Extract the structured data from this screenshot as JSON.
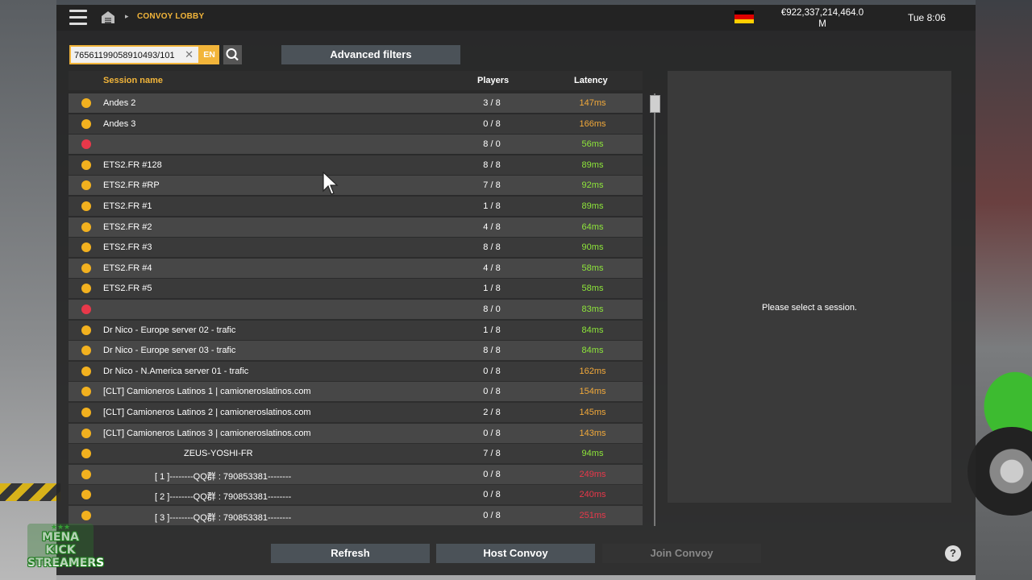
{
  "header": {
    "breadcrumb": "CONVOY LOBBY",
    "money": "€922,337,214,464.0",
    "money_unit": "M",
    "clock": "Tue 8:06",
    "flag_colors": [
      "#000000",
      "#dd0000",
      "#ffce00"
    ]
  },
  "search": {
    "value": "76561199058910493/101",
    "lang": "EN",
    "advanced_label": "Advanced filters"
  },
  "table": {
    "columns": [
      "Session name",
      "Players",
      "Latency"
    ],
    "rows": [
      {
        "status": "ok",
        "name": "Andes 2",
        "players": "3 / 8",
        "latency": "147ms",
        "lat_color": "#f2a93a",
        "indent": 0
      },
      {
        "status": "ok",
        "name": "Andes 3",
        "players": "0 / 8",
        "latency": "166ms",
        "lat_color": "#f2a93a",
        "indent": 0
      },
      {
        "status": "bad",
        "name": "",
        "players": "8 / 0",
        "latency": "56ms",
        "lat_color": "#8ee63a",
        "indent": 0
      },
      {
        "status": "ok",
        "name": "ETS2.FR #128",
        "players": "8 / 8",
        "latency": "89ms",
        "lat_color": "#8ee63a",
        "indent": 0
      },
      {
        "status": "ok",
        "name": "ETS2.FR #RP",
        "players": "7 / 8",
        "latency": "92ms",
        "lat_color": "#8ee63a",
        "indent": 0
      },
      {
        "status": "ok",
        "name": "ETS2.FR #1",
        "players": "1 / 8",
        "latency": "89ms",
        "lat_color": "#8ee63a",
        "indent": 0
      },
      {
        "status": "ok",
        "name": "ETS2.FR #2",
        "players": "4 / 8",
        "latency": "64ms",
        "lat_color": "#8ee63a",
        "indent": 0
      },
      {
        "status": "ok",
        "name": "ETS2.FR #3",
        "players": "8 / 8",
        "latency": "90ms",
        "lat_color": "#8ee63a",
        "indent": 0
      },
      {
        "status": "ok",
        "name": "ETS2.FR #4",
        "players": "4 / 8",
        "latency": "58ms",
        "lat_color": "#8ee63a",
        "indent": 0
      },
      {
        "status": "ok",
        "name": "ETS2.FR #5",
        "players": "1 / 8",
        "latency": "58ms",
        "lat_color": "#8ee63a",
        "indent": 0
      },
      {
        "status": "bad",
        "name": "",
        "players": "8 / 0",
        "latency": "83ms",
        "lat_color": "#8ee63a",
        "indent": 0
      },
      {
        "status": "ok",
        "name": "Dr Nico - Europe server 02 - trafic",
        "players": "1 / 8",
        "latency": "84ms",
        "lat_color": "#8ee63a",
        "indent": 0
      },
      {
        "status": "ok",
        "name": "Dr Nico - Europe server 03 - trafic",
        "players": "8 / 8",
        "latency": "84ms",
        "lat_color": "#8ee63a",
        "indent": 0
      },
      {
        "status": "ok",
        "name": "Dr Nico - N.America server 01 - trafic",
        "players": "0 / 8",
        "latency": "162ms",
        "lat_color": "#f2a93a",
        "indent": 0
      },
      {
        "status": "ok",
        "name": "[CLT] Camioneros Latinos 1 | camioneroslatinos.com",
        "players": "0 / 8",
        "latency": "154ms",
        "lat_color": "#f2a93a",
        "indent": 0
      },
      {
        "status": "ok",
        "name": "[CLT] Camioneros Latinos 2 | camioneroslatinos.com",
        "players": "2 / 8",
        "latency": "145ms",
        "lat_color": "#f2a93a",
        "indent": 0
      },
      {
        "status": "ok",
        "name": "[CLT] Camioneros Latinos 3 | camioneroslatinos.com",
        "players": "0 / 8",
        "latency": "143ms",
        "lat_color": "#f2a93a",
        "indent": 0
      },
      {
        "status": "ok",
        "name": "ZEUS-YOSHI-FR",
        "players": "7 / 8",
        "latency": "94ms",
        "lat_color": "#8ee63a",
        "indent": 2
      },
      {
        "status": "ok",
        "name": "[ 1 ]--------QQ群 : 790853381--------",
        "players": "0 / 8",
        "latency": "249ms",
        "lat_color": "#e8384a",
        "indent": 1
      },
      {
        "status": "ok",
        "name": "[ 2 ]--------QQ群 : 790853381--------",
        "players": "0 / 8",
        "latency": "240ms",
        "lat_color": "#e8384a",
        "indent": 1
      },
      {
        "status": "ok",
        "name": "[ 3 ]--------QQ群 : 790853381--------",
        "players": "0 / 8",
        "latency": "251ms",
        "lat_color": "#e8384a",
        "indent": 1
      }
    ]
  },
  "detail": {
    "placeholder": "Please select a session."
  },
  "footer": {
    "refresh": "Refresh",
    "host": "Host Convoy",
    "join": "Join Convoy",
    "help": "?"
  },
  "logo": {
    "line1": "MENA KICK",
    "line2": "STREAMERS",
    "stars": "★★★"
  }
}
